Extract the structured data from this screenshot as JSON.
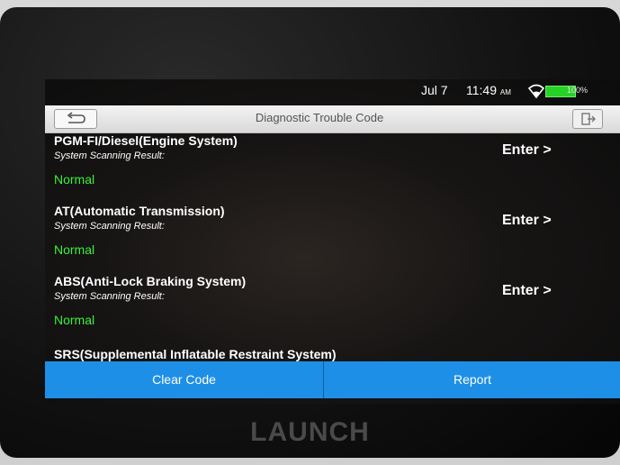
{
  "status_bar": {
    "date": "Jul 7",
    "time": "11:49",
    "ampm": "AM",
    "battery_percent": "100%",
    "battery_color": "#26d226"
  },
  "titlebar": {
    "title": "Diagnostic Trouble Code",
    "back_icon": "back-arrow-icon",
    "exit_icon": "exit-icon"
  },
  "systems": [
    {
      "name": "PGM-FI/Diesel(Engine System)",
      "scan_label": "System Scanning Result:",
      "status": "Normal",
      "enter": "Enter >"
    },
    {
      "name": "AT(Automatic Transmission)",
      "scan_label": "System Scanning Result:",
      "status": "Normal",
      "enter": "Enter >"
    },
    {
      "name": "ABS(Anti-Lock Braking System)",
      "scan_label": "System Scanning Result:",
      "status": "Normal",
      "enter": "Enter >"
    },
    {
      "name": "SRS(Supplemental Inflatable Restraint System)"
    }
  ],
  "buttons": {
    "clear": "Clear Code",
    "report": "Report"
  },
  "brand": "LAUNCH",
  "colors": {
    "accent": "#1e8fe6",
    "normal_status": "#3cf03c"
  }
}
